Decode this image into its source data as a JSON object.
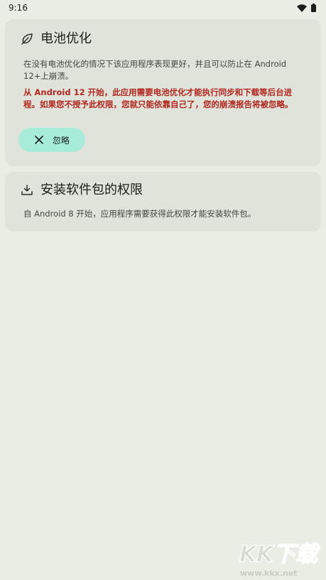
{
  "status_bar": {
    "time": "9:16",
    "icons": [
      "wifi-icon",
      "battery-icon"
    ]
  },
  "battery_card": {
    "icon": "leaf-icon",
    "title": "电池优化",
    "description": "在没有电池优化的情况下该应用程序表现更好，并且可以防止在 Android 12+上崩溃。",
    "warning": "从 Android 12 开始，此应用需要电池优化才能执行同步和下载等后台进程。如果您不授予此权限，您就只能依靠自己了，您的崩溃报告将被忽略。",
    "button_label": "忽略",
    "button_icon": "close-icon"
  },
  "install_card": {
    "icon": "download-tray-icon",
    "title": "安装软件包的权限",
    "description": "自 Android 8 开始，应用程序需要获得此权限才能安装软件包。"
  },
  "watermark": {
    "logo_text": "KK下载",
    "url": "www.kkx.net"
  },
  "colors": {
    "background": "#eaede4",
    "card": "#e0e3da",
    "button": "#a6ecd9",
    "warning": "#b3261e"
  }
}
